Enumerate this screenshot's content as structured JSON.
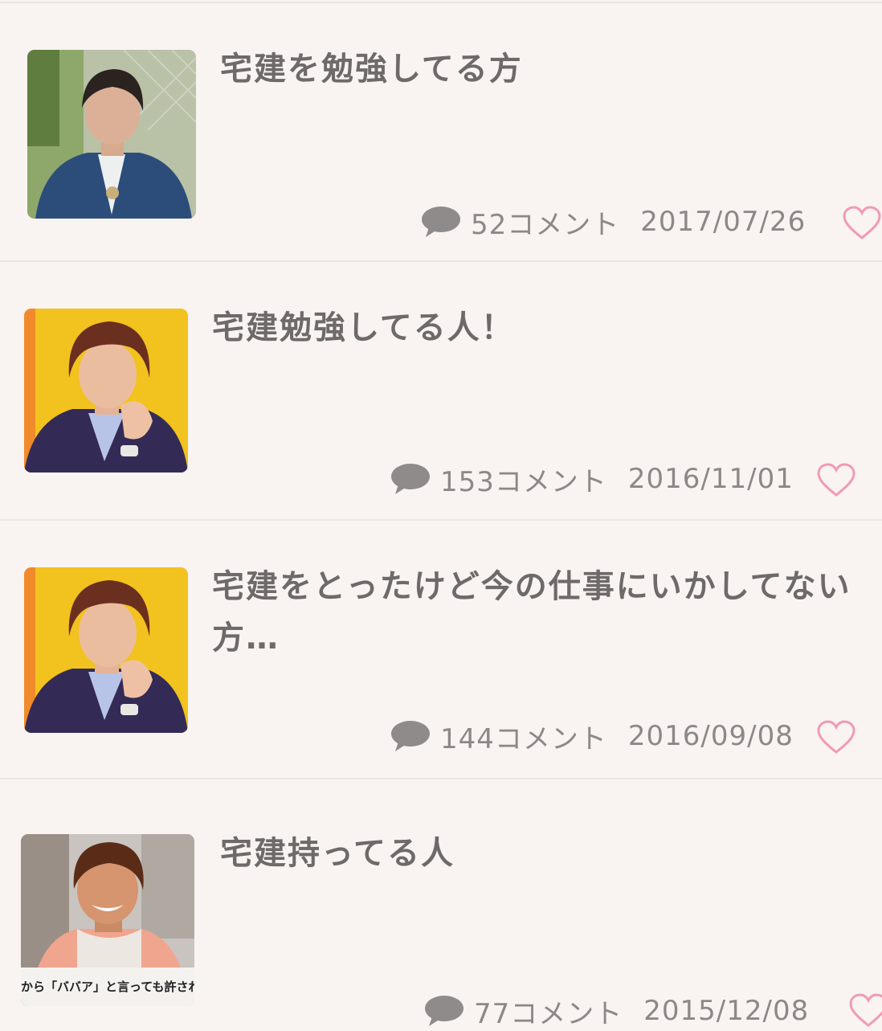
{
  "topics": [
    {
      "title": "宅建を勉強してる方",
      "comment_count": "52コメント",
      "date": "2017/07/26",
      "icons": {
        "comment": "speech-bubble-icon",
        "favorite": "heart-icon"
      }
    },
    {
      "title": "宅建勉強してる人！",
      "comment_count": "153コメント",
      "date": "2016/11/01",
      "icons": {
        "comment": "speech-bubble-icon",
        "favorite": "heart-icon"
      }
    },
    {
      "title": "宅建をとったけど今の仕事にいかしてない方…",
      "comment_count": "144コメント",
      "date": "2016/09/08",
      "icons": {
        "comment": "speech-bubble-icon",
        "favorite": "heart-icon"
      }
    },
    {
      "title": "宅建持ってる人",
      "comment_count": "77コメント",
      "date": "2015/12/08",
      "icons": {
        "comment": "speech-bubble-icon",
        "favorite": "heart-icon"
      },
      "thumbnail_caption": "から「ババア」と言っても許され"
    }
  ],
  "colors": {
    "background": "#f9f4f1",
    "title_text": "#6e6a69",
    "meta_text": "#8d8887",
    "bubble": "#8f8b8a",
    "heart": "#f19bb3",
    "divider": "#ede5e1"
  }
}
